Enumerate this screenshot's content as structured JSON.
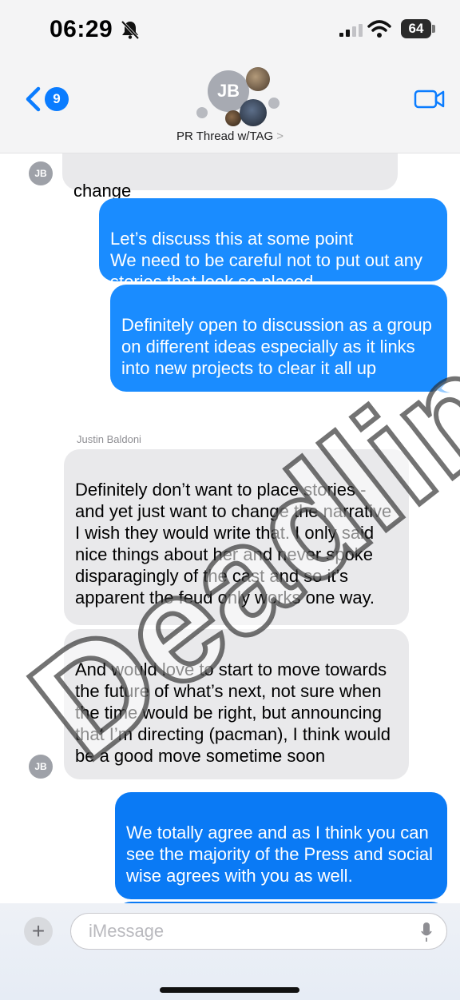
{
  "status_bar": {
    "time": "06:29",
    "battery": "64"
  },
  "header": {
    "back_count": "9",
    "avatar_initials": "JB",
    "thread_title": "PR Thread w/TAG",
    "title_chevron": ">"
  },
  "messages": [
    {
      "id": "m0",
      "direction": "incoming",
      "text": "change"
    },
    {
      "id": "m1",
      "direction": "outgoing",
      "text": "Let’s discuss this at some point\nWe need to be careful not to put out any stories that look so placed"
    },
    {
      "id": "m2",
      "direction": "outgoing",
      "text": "Definitely open to discussion as a group on different ideas especially as it links into new projects to clear it all up"
    },
    {
      "id": "m3",
      "direction": "incoming",
      "sender": "Justin Baldoni",
      "text": "Definitely don’t want to place stories - and yet just want to change the narrative\nI wish they would write that. I only said nice things about her and never spoke disparagingly of the cast and so it’s apparent the feud only works one way."
    },
    {
      "id": "m4",
      "direction": "incoming",
      "text": "And would love to start to move towards the future of what’s next, not sure when the time would be right, but announcing that I’m directing (pacman), I think would be a good move sometime soon"
    },
    {
      "id": "m5",
      "direction": "outgoing",
      "text": "We totally agree and as I think you can see the majority of the Press and social wise agrees with you as well."
    }
  ],
  "small_avatar_initials": "JB",
  "input": {
    "placeholder": "iMessage",
    "plus_label": "+"
  },
  "watermark": "Deadline",
  "colors": {
    "outgoing": "#1a8cff",
    "incoming": "#e9e9eb",
    "accent": "#0a7cff"
  },
  "icons": [
    "bell-slash-icon",
    "signal-icon",
    "wifi-icon",
    "back-chevron-icon",
    "video-camera-icon",
    "mic-icon"
  ]
}
